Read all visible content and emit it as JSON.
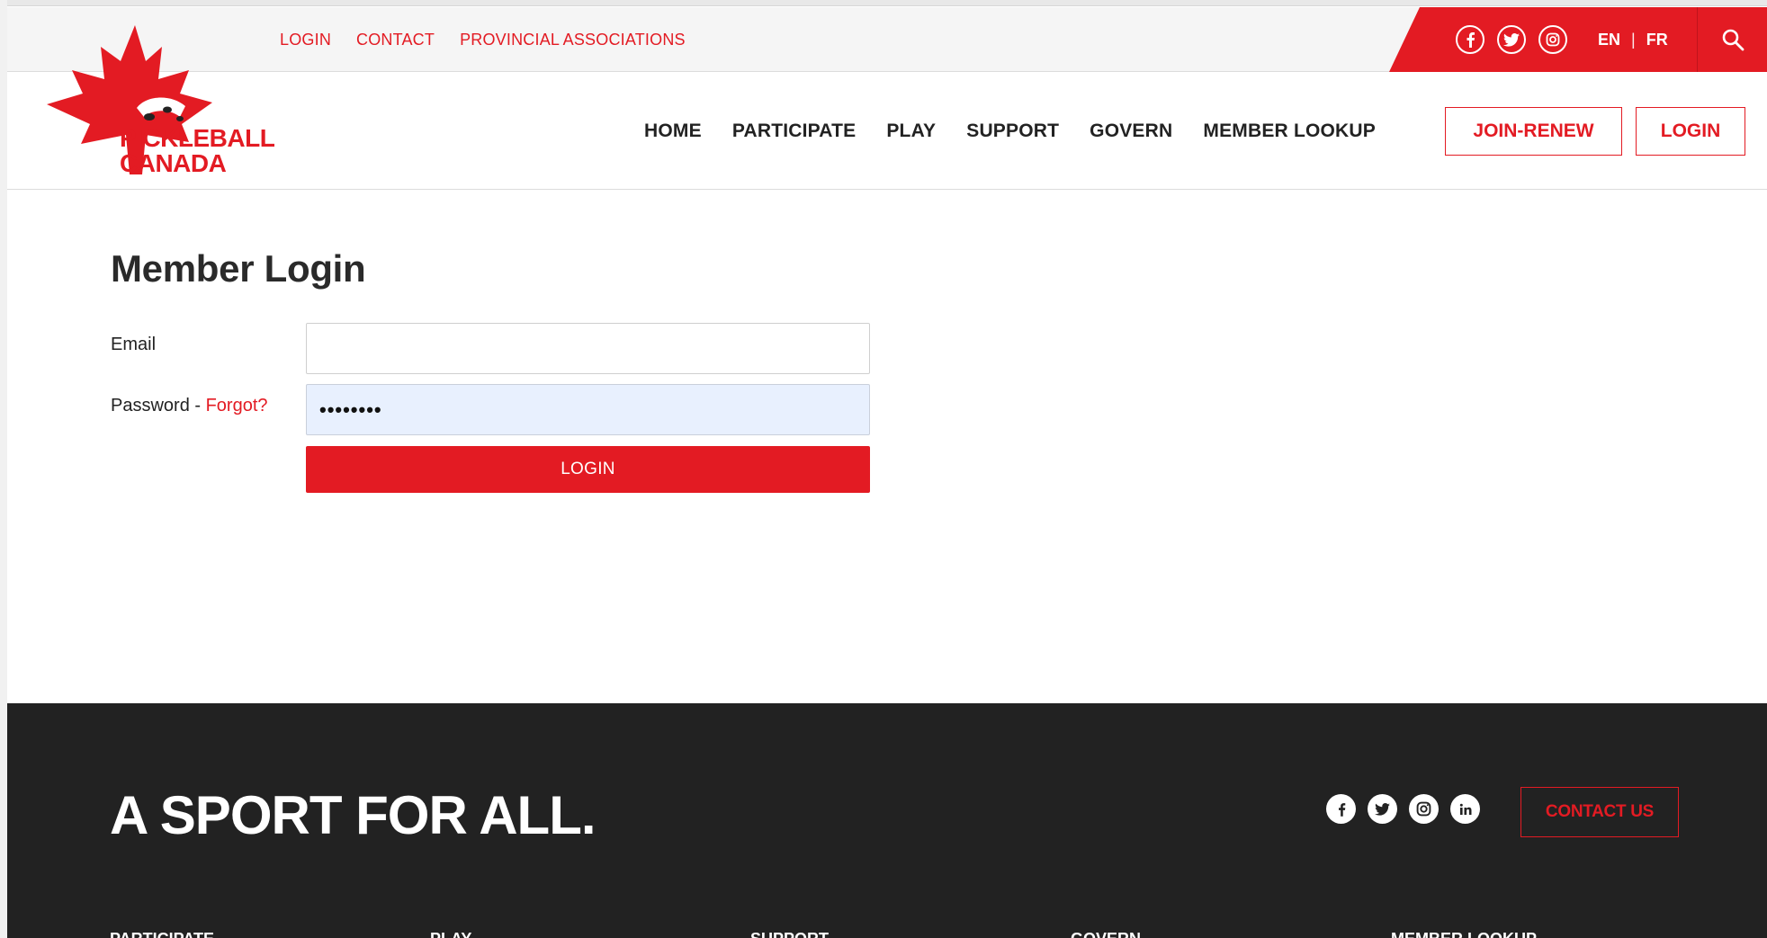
{
  "utility": {
    "links": [
      "LOGIN",
      "CONTACT",
      "PROVINCIAL ASSOCIATIONS"
    ],
    "social_icons": [
      "facebook-icon",
      "twitter-icon",
      "instagram-icon"
    ],
    "lang_en": "EN",
    "lang_sep": "|",
    "lang_fr": "FR",
    "search_icon": "search-icon"
  },
  "brand": {
    "logo_line1": "PICKLEBALL",
    "logo_line2": "CANADA",
    "accent_color": "#e31b23"
  },
  "nav": {
    "items": [
      "HOME",
      "PARTICIPATE",
      "PLAY",
      "SUPPORT",
      "GOVERN",
      "MEMBER LOOKUP"
    ],
    "join_renew": "JOIN-RENEW",
    "login": "LOGIN"
  },
  "login_form": {
    "title": "Member Login",
    "email_label": "Email",
    "email_value": "",
    "password_label": "Password - ",
    "forgot_link": "Forgot?",
    "password_value": "••••••••",
    "submit_label": "LOGIN"
  },
  "footer": {
    "tagline": "A SPORT FOR ALL.",
    "social_icons": [
      "facebook-icon",
      "twitter-icon",
      "instagram-icon",
      "linkedin-icon"
    ],
    "contact_button": "CONTACT US",
    "columns": [
      "PARTICIPATE",
      "PLAY",
      "SUPPORT",
      "GOVERN",
      "MEMBER LOOKUP"
    ],
    "background_color": "#222222"
  }
}
